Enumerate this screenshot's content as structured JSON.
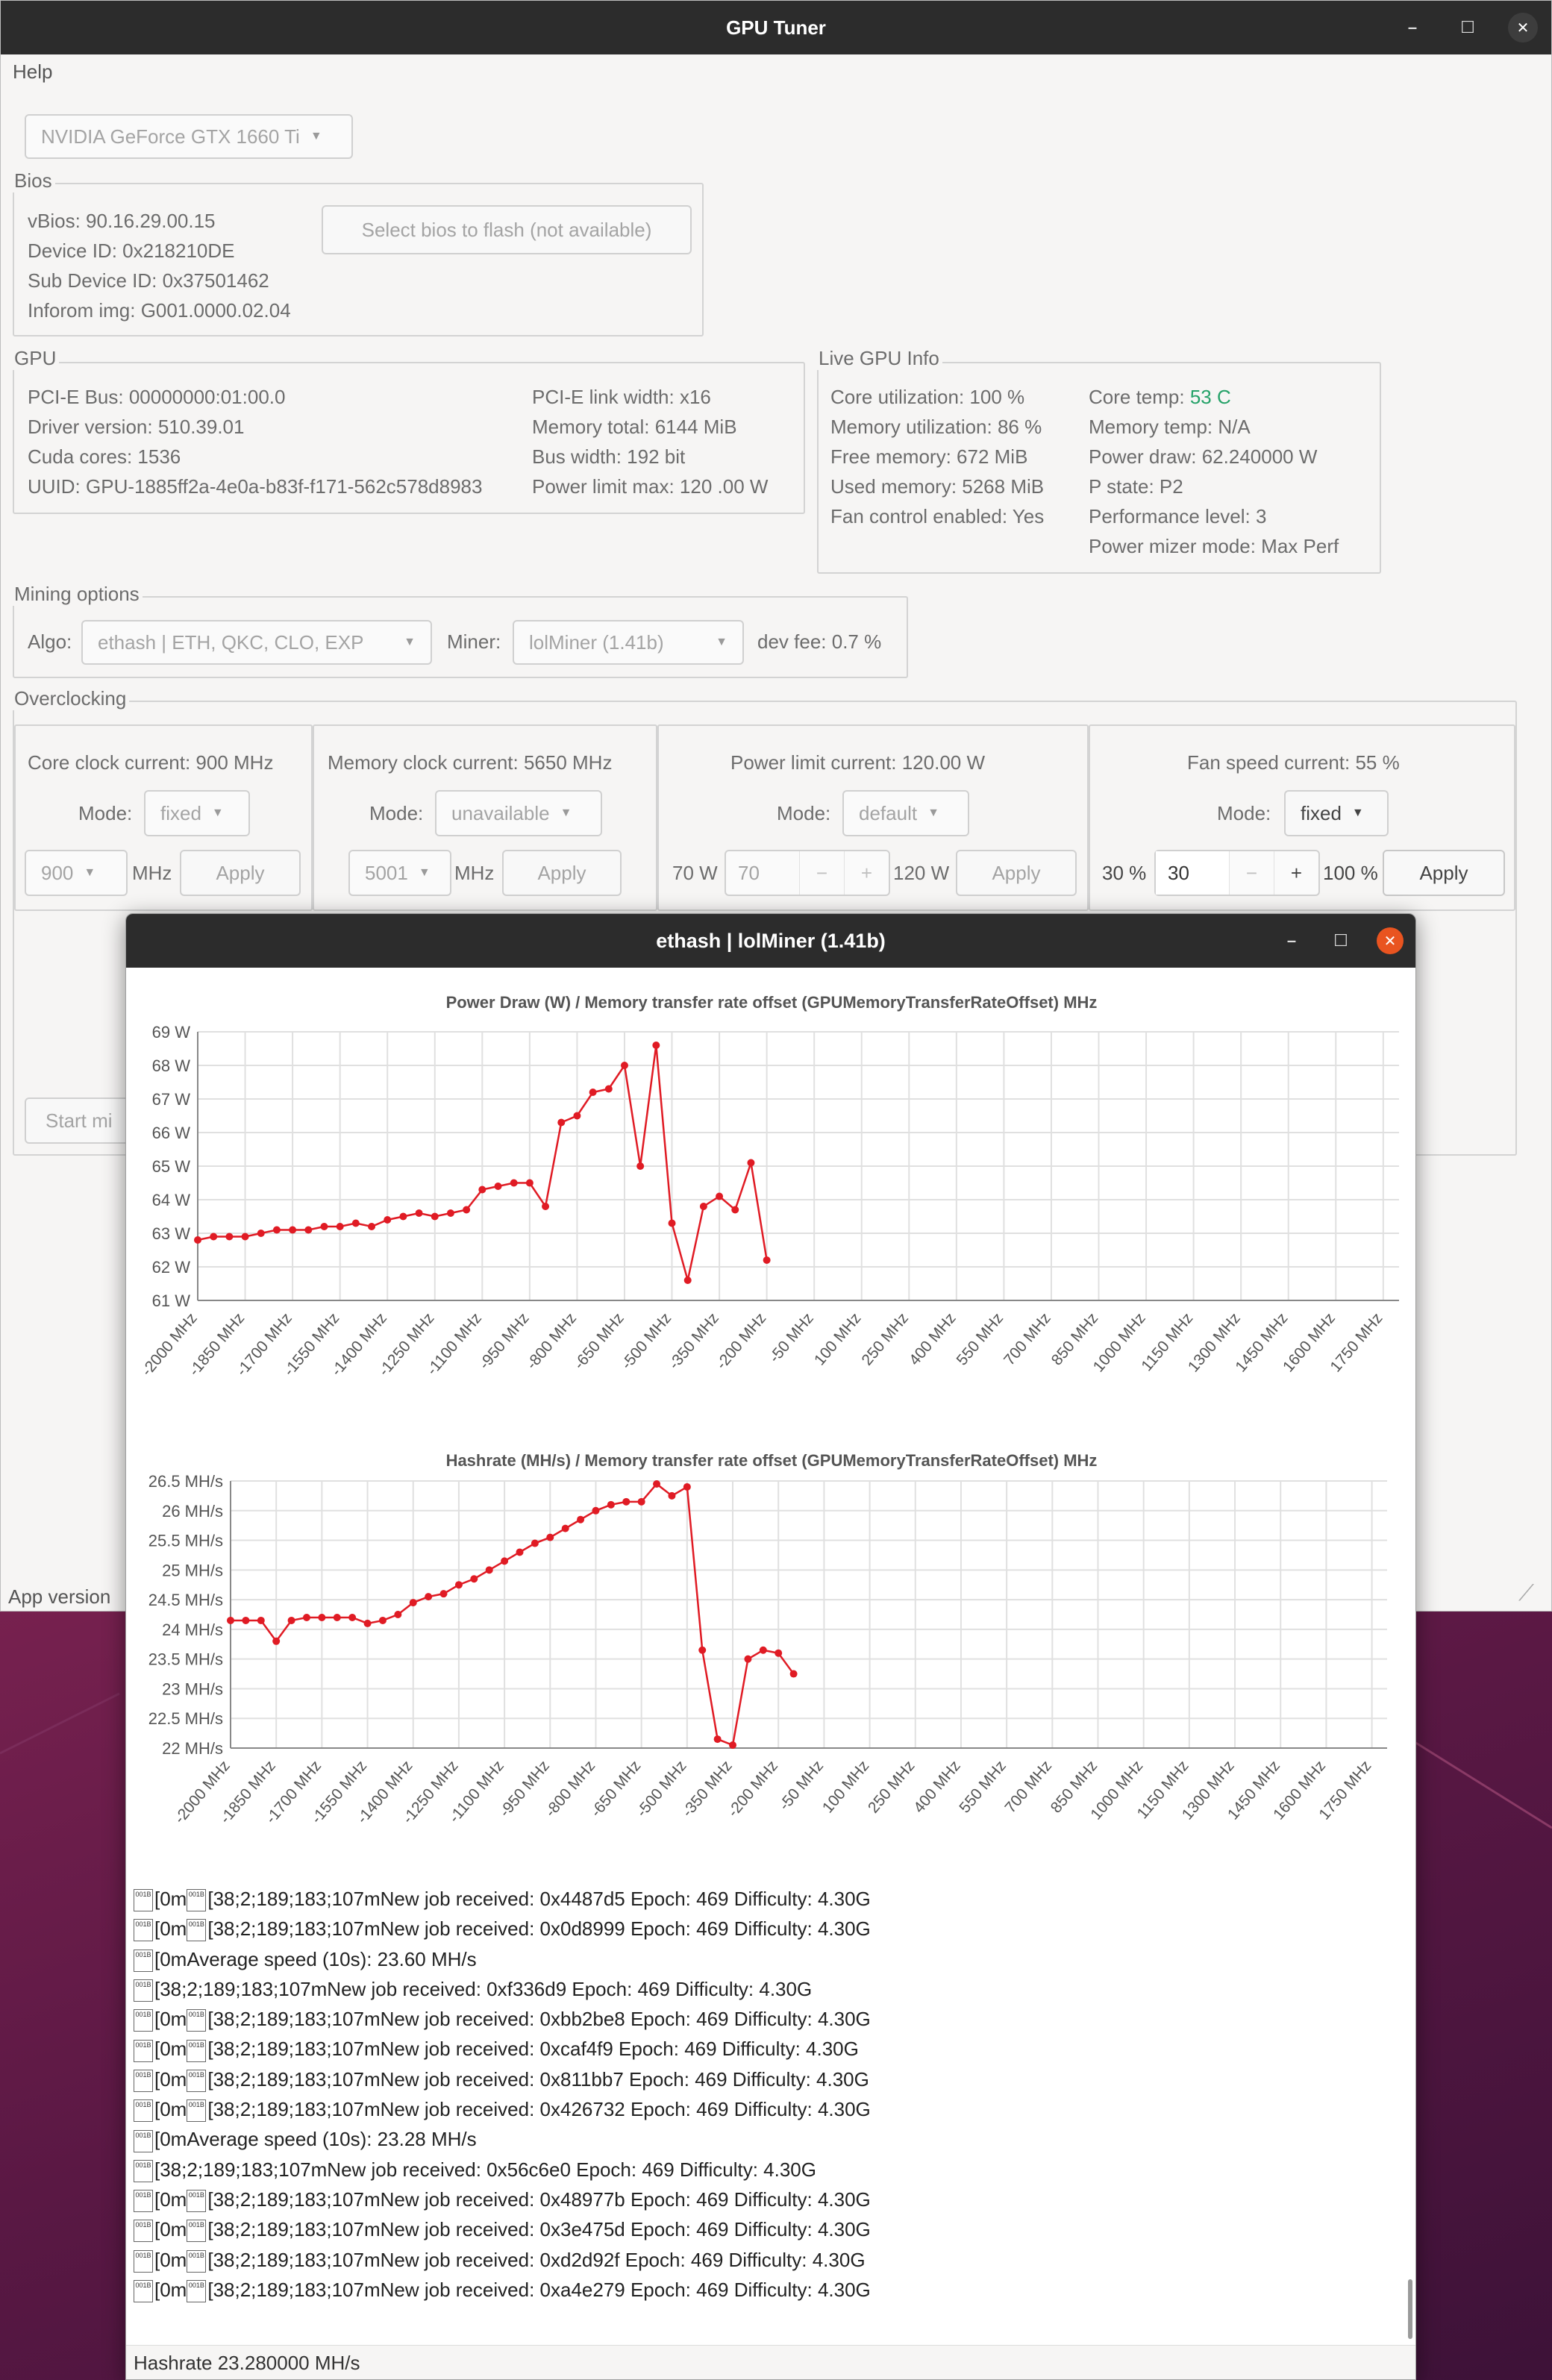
{
  "window": {
    "title": "GPU Tuner",
    "menu_help": "Help",
    "app_version_label": "App version"
  },
  "gpu_select": {
    "value": "NVIDIA GeForce GTX 1660 Ti"
  },
  "bios": {
    "title": "Bios",
    "vbios": "vBios: 90.16.29.00.15",
    "device_id": "Device ID: 0x218210DE",
    "sub_device_id": "Sub Device ID: 0x37501462",
    "inforom": "Inforom img: G001.0000.02.04",
    "flash_button": "Select bios to flash (not available)"
  },
  "gpu": {
    "title": "GPU",
    "pcie_bus": "PCI-E Bus: 00000000:01:00.0",
    "driver": "Driver version: 510.39.01",
    "cuda": "Cuda cores: 1536",
    "uuid": "UUID: GPU-1885ff2a-4e0a-b83f-f171-562c578d8983",
    "link_width": "PCI-E link width: x16",
    "mem_total": "Memory total: 6144 MiB",
    "bus_width": "Bus width: 192 bit",
    "power_max": "Power limit max: 120 .00 W"
  },
  "live": {
    "title": "Live GPU Info",
    "core_util": "Core utilization: 100 %",
    "mem_util": "Memory utilization: 86 %",
    "free_mem": "Free memory: 672 MiB",
    "used_mem": "Used memory: 5268 MiB",
    "fan_ctrl": "Fan control enabled: Yes",
    "core_temp_label": "Core temp:",
    "core_temp_value": "53 C",
    "mem_temp": "Memory temp: N/A",
    "power_draw": "Power draw: 62.240000 W",
    "pstate": "P state: P2",
    "perf_level": "Performance level: 3",
    "mizer": "Power mizer mode: Max Perf"
  },
  "mining": {
    "title": "Mining options",
    "algo_label": "Algo:",
    "algo_value": "ethash | ETH, QKC, CLO, EXP",
    "miner_label": "Miner:",
    "miner_value": "lolMiner (1.41b)",
    "dev_fee": "dev fee: 0.7 %"
  },
  "oc": {
    "title": "Overclocking",
    "mode_label": "Mode:",
    "apply": "Apply",
    "start_button": "Start mi",
    "core": {
      "current": "Core clock current: 900 MHz",
      "mode": "fixed",
      "value": "900",
      "unit": "MHz"
    },
    "memory": {
      "current": "Memory clock current: 5650 MHz",
      "mode": "unavailable",
      "value": "5001",
      "unit": "MHz"
    },
    "power": {
      "current": "Power limit current: 120.00 W",
      "mode": "default",
      "min": "70 W",
      "value": "70",
      "max": "120 W",
      "minus": "−",
      "plus": "+"
    },
    "fan": {
      "current": "Fan speed current: 55 %",
      "mode": "fixed",
      "min": "30 %",
      "value": "30",
      "max": "100 %",
      "minus": "−",
      "plus": "+"
    }
  },
  "popup": {
    "title": "ethash | lolMiner (1.41b)",
    "status": "Hashrate 23.280000 MH/s",
    "log": [
      {
        "p": "[0m",
        "t": "[38;2;189;183;107mNew job received: 0x4487d5 Epoch: 469 Difficulty: 4.30G"
      },
      {
        "p": "[0m",
        "t": "[38;2;189;183;107mNew job received: 0x0d8999 Epoch: 469 Difficulty: 4.30G"
      },
      {
        "p": "",
        "t": "[0mAverage speed (10s): 23.60 MH/s"
      },
      {
        "p": "",
        "t": "[38;2;189;183;107mNew job received: 0xf336d9 Epoch: 469 Difficulty: 4.30G"
      },
      {
        "p": "[0m",
        "t": "[38;2;189;183;107mNew job received: 0xbb2be8 Epoch: 469 Difficulty: 4.30G"
      },
      {
        "p": "[0m",
        "t": "[38;2;189;183;107mNew job received: 0xcaf4f9 Epoch: 469 Difficulty: 4.30G"
      },
      {
        "p": "[0m",
        "t": "[38;2;189;183;107mNew job received: 0x811bb7 Epoch: 469 Difficulty: 4.30G"
      },
      {
        "p": "[0m",
        "t": "[38;2;189;183;107mNew job received: 0x426732 Epoch: 469 Difficulty: 4.30G"
      },
      {
        "p": "",
        "t": "[0mAverage speed (10s): 23.28 MH/s"
      },
      {
        "p": "",
        "t": "[38;2;189;183;107mNew job received: 0x56c6e0 Epoch: 469 Difficulty: 4.30G"
      },
      {
        "p": "[0m",
        "t": "[38;2;189;183;107mNew job received: 0x48977b Epoch: 469 Difficulty: 4.30G"
      },
      {
        "p": "[0m",
        "t": "[38;2;189;183;107mNew job received: 0x3e475d Epoch: 469 Difficulty: 4.30G"
      },
      {
        "p": "[0m",
        "t": "[38;2;189;183;107mNew job received: 0xd2d92f Epoch: 469 Difficulty: 4.30G"
      },
      {
        "p": "[0m",
        "t": "[38;2;189;183;107mNew job received: 0xa4e279 Epoch: 469 Difficulty: 4.30G"
      }
    ]
  },
  "colors": {
    "line": "#e01b24",
    "titlebar": "#2c2c2c",
    "close_orange": "#e95420",
    "accent_green": "#26a269"
  },
  "chart_data": [
    {
      "type": "line",
      "title": "Power Draw (W) / Memory transfer rate offset (GPUMemoryTransferRateOffset) MHz",
      "y_unit": " W",
      "ylim": [
        61,
        69
      ],
      "yticks": [
        61,
        62,
        63,
        64,
        65,
        66,
        67,
        68,
        69
      ],
      "xlim": [
        -2000,
        1800
      ],
      "xticks": [
        -2000,
        -1850,
        -1700,
        -1550,
        -1400,
        -1250,
        -1100,
        -950,
        -800,
        -650,
        -500,
        -350,
        -200,
        -50,
        100,
        250,
        400,
        550,
        700,
        850,
        1000,
        1150,
        1300,
        1450,
        1600,
        1750
      ],
      "x_unit": " MHz",
      "grid": true,
      "series": [
        {
          "x": [
            -2000,
            -1950,
            -1900,
            -1850,
            -1800,
            -1750,
            -1700,
            -1650,
            -1600,
            -1550,
            -1500,
            -1450,
            -1400,
            -1350,
            -1300,
            -1250,
            -1200,
            -1150,
            -1100,
            -1050,
            -1000,
            -950,
            -900,
            -850,
            -800,
            -750,
            -700,
            -650,
            -600,
            -550,
            -500,
            -450,
            -400,
            -350,
            -300,
            -250,
            -200
          ],
          "y": [
            62.8,
            62.9,
            62.9,
            62.9,
            63.0,
            63.1,
            63.1,
            63.1,
            63.2,
            63.2,
            63.3,
            63.2,
            63.4,
            63.5,
            63.6,
            63.5,
            63.6,
            63.7,
            64.3,
            64.4,
            64.5,
            64.5,
            63.8,
            66.3,
            66.5,
            67.2,
            67.3,
            68.0,
            65.0,
            68.6,
            63.3,
            61.6,
            63.8,
            64.1,
            63.7,
            65.1,
            62.2
          ]
        }
      ]
    },
    {
      "type": "line",
      "title": "Hashrate (MH/s) / Memory transfer rate offset (GPUMemoryTransferRateOffset) MHz",
      "y_unit": " MH/s",
      "ylim": [
        22,
        26.5
      ],
      "yticks": [
        22,
        22.5,
        23,
        23.5,
        24,
        24.5,
        25,
        25.5,
        26,
        26.5
      ],
      "xlim": [
        -2000,
        1800
      ],
      "xticks": [
        -2000,
        -1850,
        -1700,
        -1550,
        -1400,
        -1250,
        -1100,
        -950,
        -800,
        -650,
        -500,
        -350,
        -200,
        -50,
        100,
        250,
        400,
        550,
        700,
        850,
        1000,
        1150,
        1300,
        1450,
        1600,
        1750
      ],
      "x_unit": " MHz",
      "grid": true,
      "series": [
        {
          "x": [
            -2000,
            -1950,
            -1900,
            -1850,
            -1800,
            -1750,
            -1700,
            -1650,
            -1600,
            -1550,
            -1500,
            -1450,
            -1400,
            -1350,
            -1300,
            -1250,
            -1200,
            -1150,
            -1100,
            -1050,
            -1000,
            -950,
            -900,
            -850,
            -800,
            -750,
            -700,
            -650,
            -600,
            -550,
            -500,
            -450,
            -400,
            -350,
            -300,
            -250,
            -200,
            -150
          ],
          "y": [
            24.15,
            24.15,
            24.15,
            23.8,
            24.15,
            24.2,
            24.2,
            24.2,
            24.2,
            24.1,
            24.15,
            24.25,
            24.45,
            24.55,
            24.6,
            24.75,
            24.85,
            25.0,
            25.15,
            25.3,
            25.45,
            25.55,
            25.7,
            25.85,
            26.0,
            26.1,
            26.15,
            26.15,
            26.45,
            26.25,
            26.4,
            23.65,
            22.15,
            22.05,
            23.5,
            23.65,
            23.6,
            23.25
          ]
        }
      ]
    }
  ]
}
